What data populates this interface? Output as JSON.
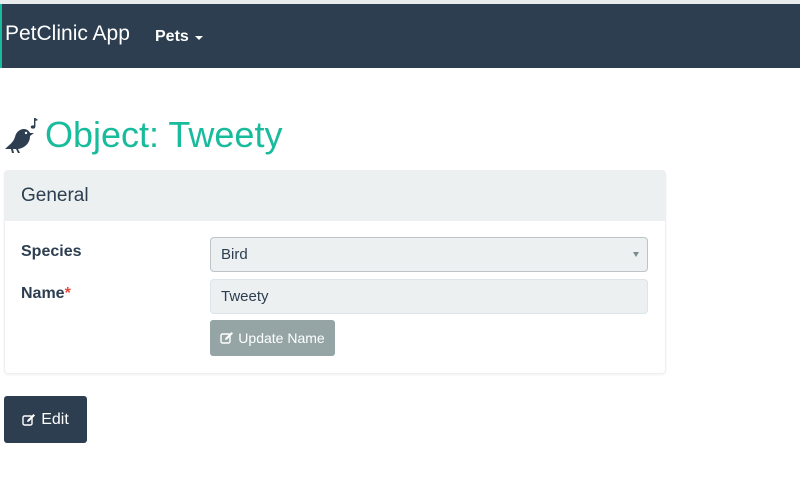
{
  "navbar": {
    "brand": "PetClinic App",
    "pets_menu": "Pets"
  },
  "page": {
    "title": "Object: Tweety",
    "title_icon": "songbird-icon"
  },
  "panel": {
    "heading": "General",
    "fields": {
      "species": {
        "label": "Species",
        "value": "Bird"
      },
      "name": {
        "label": "Name",
        "required_marker": "*",
        "value": "Tweety"
      }
    },
    "update_name_button": "Update Name"
  },
  "actions": {
    "edit_button": "Edit"
  },
  "colors": {
    "navbar_bg": "#2c3e50",
    "title_accent": "#18bc9c",
    "panel_heading_bg": "#ecf0f1",
    "required_marker": "#e74c3c",
    "update_button_bg": "#95a5a6",
    "edit_button_bg": "#2c3e50"
  }
}
